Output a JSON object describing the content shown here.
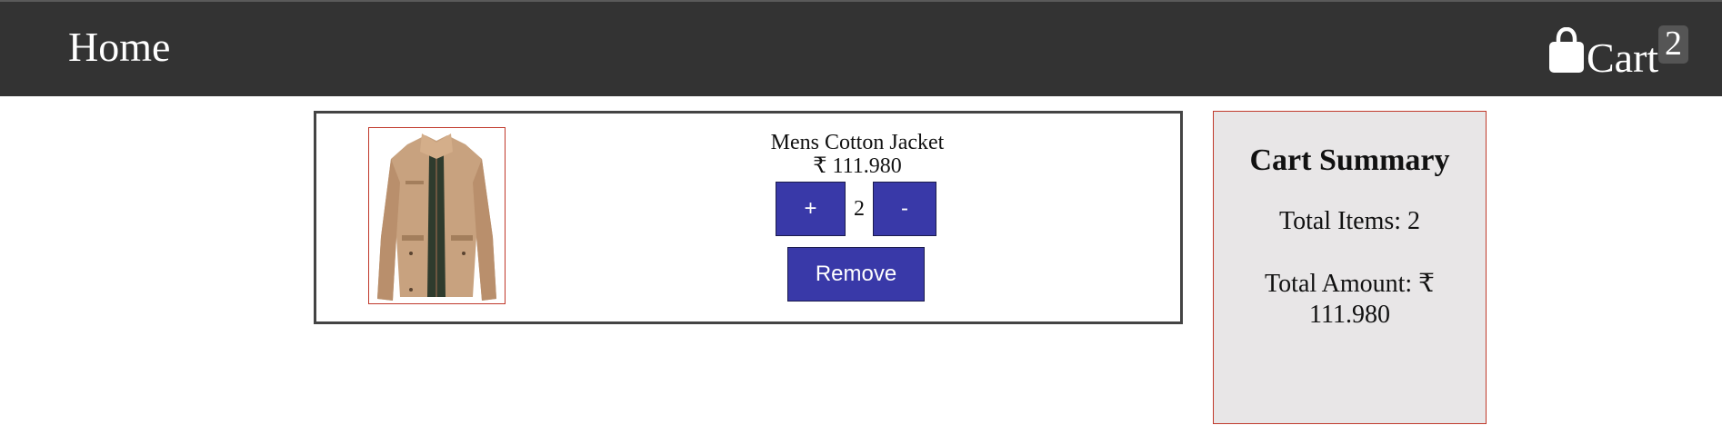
{
  "navbar": {
    "home_label": "Home",
    "cart_label": "Cart",
    "cart_count": "2",
    "cart_icon": "shopping-bag-icon",
    "background_color": "#333333"
  },
  "cart_item": {
    "image": "mens-cotton-jacket-image",
    "title": "Mens Cotton Jacket",
    "price": "₹ 111.980",
    "increment_label": "+",
    "quantity": "2",
    "decrement_label": "-",
    "remove_label": "Remove",
    "button_color": "#3939a8"
  },
  "summary": {
    "title": "Cart Summary",
    "total_items": "Total Items: 2",
    "total_amount": "Total Amount: ₹ 111.980",
    "background_color": "#e8e6e7",
    "border_color": "#c0392b"
  }
}
